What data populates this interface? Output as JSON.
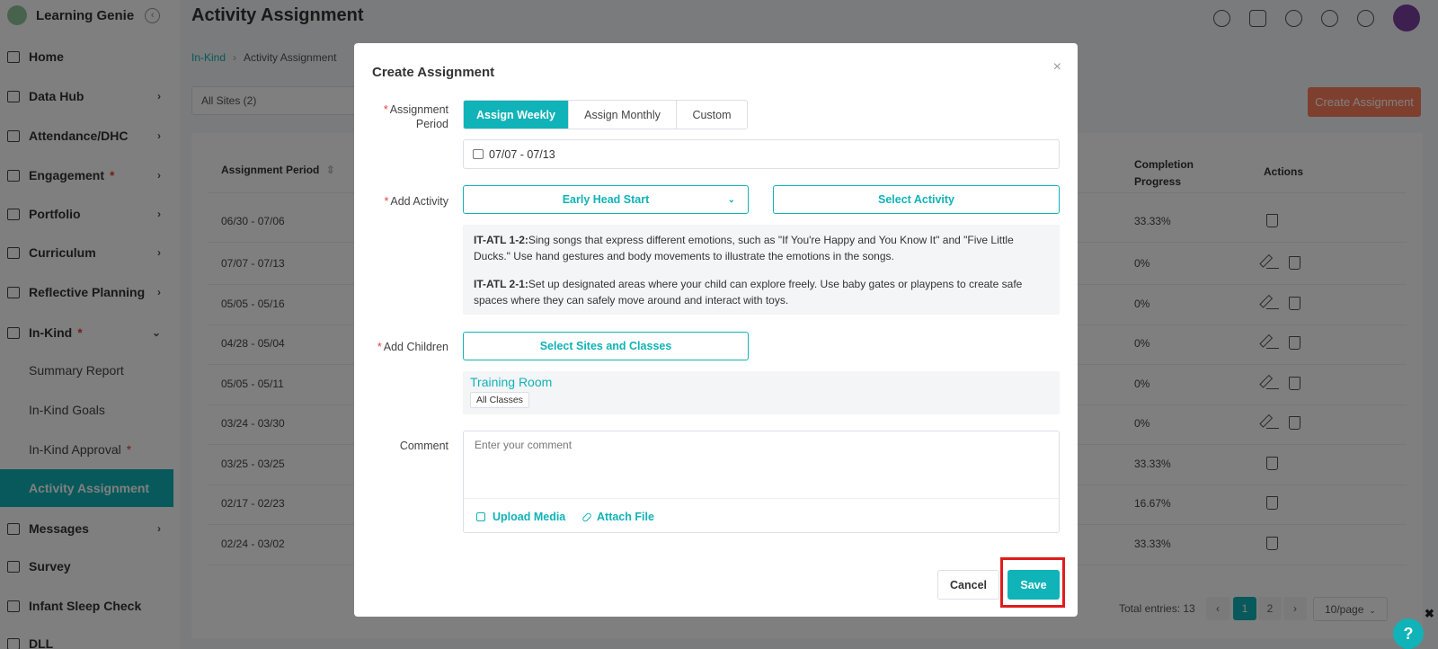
{
  "app": {
    "brand": "Learning Genie",
    "page_title": "Activity Assignment"
  },
  "sidebar": {
    "items": [
      {
        "label": "Home",
        "has_chevron": false,
        "required": false
      },
      {
        "label": "Data Hub",
        "has_chevron": true,
        "required": false
      },
      {
        "label": "Attendance/DHC",
        "has_chevron": true,
        "required": false
      },
      {
        "label": "Engagement",
        "has_chevron": true,
        "required": true
      },
      {
        "label": "Portfolio",
        "has_chevron": true,
        "required": false
      },
      {
        "label": "Curriculum",
        "has_chevron": true,
        "required": false
      },
      {
        "label": "Reflective Planning",
        "has_chevron": true,
        "required": false
      },
      {
        "label": "In-Kind",
        "has_chevron": true,
        "required": true,
        "expanded": true
      },
      {
        "label": "Messages",
        "has_chevron": true,
        "required": false
      },
      {
        "label": "Survey",
        "has_chevron": false,
        "required": false
      },
      {
        "label": "Infant Sleep Check",
        "has_chevron": false,
        "required": false
      },
      {
        "label": "DLL",
        "has_chevron": false,
        "required": false
      }
    ],
    "sub_items": [
      {
        "label": "Summary Report",
        "active": false
      },
      {
        "label": "In-Kind Goals",
        "active": false
      },
      {
        "label": "In-Kind Approval",
        "active": false,
        "required": true
      },
      {
        "label": "Activity Assignment",
        "active": true
      }
    ],
    "required_mark": "*"
  },
  "breadcrumb": {
    "parent": "In-Kind",
    "current": "Activity Assignment"
  },
  "filters": {
    "site_select": "All Sites  (2)"
  },
  "toolbar": {
    "create_label": "Create Assignment"
  },
  "table": {
    "headers": {
      "period": "Assignment Period",
      "completion": "Completion Progress",
      "actions": "Actions"
    },
    "rows": [
      {
        "period": "06/30 - 07/06",
        "progress": "33.33%",
        "editable": false
      },
      {
        "period": "07/07 - 07/13",
        "progress": "0%",
        "editable": true
      },
      {
        "period": "05/05 - 05/16",
        "progress": "0%",
        "editable": true
      },
      {
        "period": "04/28 - 05/04",
        "progress": "0%",
        "editable": true
      },
      {
        "period": "05/05 - 05/11",
        "progress": "0%",
        "editable": true
      },
      {
        "period": "03/24 - 03/30",
        "progress": "0%",
        "editable": true
      },
      {
        "period": "03/25 - 03/25",
        "progress": "33.33%",
        "editable": false
      },
      {
        "period": "02/17 - 02/23",
        "progress": "16.67%",
        "editable": false
      },
      {
        "period": "02/24 - 03/02",
        "progress": "33.33%",
        "editable": false
      }
    ]
  },
  "pagination": {
    "total": "Total entries: 13",
    "prev": "‹",
    "next": "›",
    "pages": [
      "1",
      "2"
    ],
    "current": "1",
    "page_size": "10/page"
  },
  "modal": {
    "title": "Create Assignment",
    "close": "×",
    "period_label": "Assignment Period",
    "period_options": [
      "Assign Weekly",
      "Assign Monthly",
      "Custom"
    ],
    "period_selected": "Assign Weekly",
    "date_range": "07/07 - 07/13",
    "activity_label": "Add Activity",
    "program_select": "Early Head Start",
    "select_activity": "Select Activity",
    "activities": [
      {
        "code": "IT-ATL 1-2:",
        "text": "Sing songs that express different emotions, such as \"If You're Happy and You Know It\" and \"Five Little Ducks.\" Use hand gestures and body movements to illustrate the emotions in the songs."
      },
      {
        "code": "IT-ATL 2-1:",
        "text": "Set up designated areas where your child can explore freely. Use baby gates or playpens to create safe spaces where they can safely move around and interact with toys."
      }
    ],
    "children_label": "Add Children",
    "select_sites": "Select Sites and Classes",
    "room": "Training Room",
    "class_tag": "All Classes",
    "comment_label": "Comment",
    "comment_placeholder": "Enter your comment",
    "upload_media": "Upload Media",
    "attach_file": "Attach File",
    "cancel": "Cancel",
    "save": "Save"
  },
  "help": {
    "label": "?",
    "close": "✖"
  },
  "colors": {
    "accent": "#10b3b7",
    "create_button": "#ff7f5c",
    "required": "#e0443b",
    "highlight": "#e01b1b"
  }
}
